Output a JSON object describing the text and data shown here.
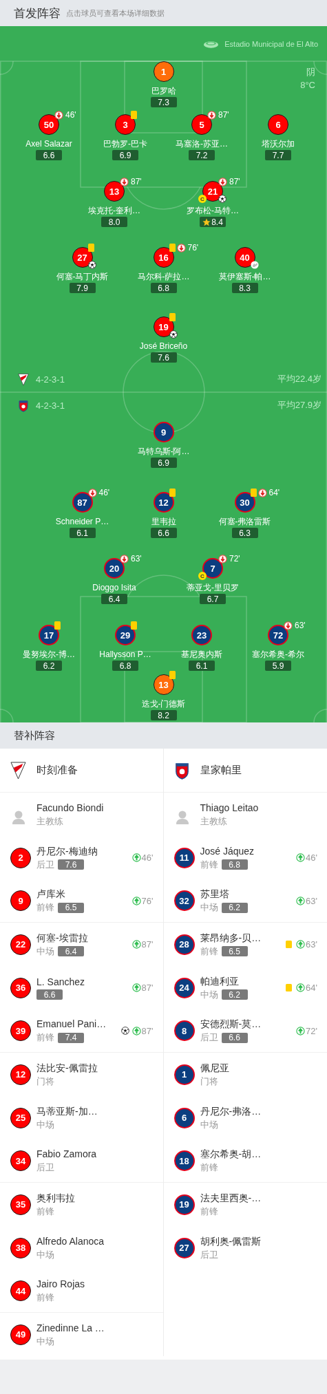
{
  "header": {
    "title": "首发阵容",
    "hint": "点击球员可查看本场详细数据"
  },
  "pitch": {
    "stadium": "Estadio Municipal de El Alto",
    "weather": "阴",
    "temperature": "8°C",
    "home": {
      "formation": "4-2-3-1",
      "average_age": "平均22.4岁",
      "lines": [
        [
          {
            "number": "1",
            "name": "巴罗哈",
            "rating": "7.3",
            "goalkeeper": true,
            "yellow_card": false,
            "goal": false,
            "assist": false,
            "best": false
          }
        ],
        [
          {
            "number": "50",
            "name": "Axel Salazar",
            "rating": "6.6",
            "goalkeeper": false,
            "yellow_card": false,
            "goal": false,
            "assist": false,
            "best": false,
            "sub_off": "46'"
          },
          {
            "number": "3",
            "name": "巴勃罗-巴卡",
            "rating": "6.9",
            "goalkeeper": false,
            "yellow_card": true,
            "goal": false,
            "assist": false,
            "best": false
          },
          {
            "number": "5",
            "name": "马塞洛-苏亚…",
            "rating": "7.2",
            "goalkeeper": false,
            "yellow_card": false,
            "goal": false,
            "assist": false,
            "best": false,
            "sub_off": "87'"
          },
          {
            "number": "6",
            "name": "塔沃尔加",
            "rating": "7.7",
            "goalkeeper": false,
            "yellow_card": false,
            "goal": false,
            "assist": false,
            "best": false
          }
        ],
        [
          {
            "number": "13",
            "name": "埃克托-奎利…",
            "rating": "8.0",
            "goalkeeper": false,
            "yellow_card": false,
            "goal": false,
            "assist": false,
            "best": false,
            "sub_off": "87'"
          },
          {
            "number": "21",
            "name": "罗布松-马特…",
            "rating": "8.4",
            "goalkeeper": false,
            "yellow_card": false,
            "goal": true,
            "assist": false,
            "best": true,
            "sub_off": "87'",
            "captain_badge": "C"
          }
        ],
        [
          {
            "number": "27",
            "name": "何塞-马丁内斯",
            "rating": "7.9",
            "goalkeeper": false,
            "yellow_card": true,
            "goal": true,
            "assist": false,
            "best": false
          },
          {
            "number": "16",
            "name": "马尔科-萨拉…",
            "rating": "6.8",
            "goalkeeper": false,
            "yellow_card": true,
            "goal": false,
            "assist": false,
            "best": false,
            "sub_off": "76'"
          },
          {
            "number": "40",
            "name": "莫伊塞斯-帕…",
            "rating": "8.3",
            "goalkeeper": false,
            "yellow_card": false,
            "goal": false,
            "assist": true,
            "best": false
          }
        ],
        [
          {
            "number": "19",
            "name": "José Briceño",
            "rating": "7.6",
            "goalkeeper": false,
            "yellow_card": true,
            "goal": true,
            "assist": false,
            "best": false
          }
        ]
      ]
    },
    "away": {
      "formation": "4-2-3-1",
      "average_age": "平均27.9岁",
      "lines": [
        [
          {
            "number": "9",
            "name": "马特乌斯-阿…",
            "rating": "6.9",
            "goalkeeper": false,
            "yellow_card": false,
            "goal": false,
            "assist": false,
            "best": false
          }
        ],
        [
          {
            "number": "87",
            "name": "Schneider P…",
            "rating": "6.1",
            "goalkeeper": false,
            "yellow_card": false,
            "goal": false,
            "assist": false,
            "best": false,
            "sub_off": "46'"
          },
          {
            "number": "12",
            "name": "里韦拉",
            "rating": "6.6",
            "goalkeeper": false,
            "yellow_card": true,
            "goal": false,
            "assist": false,
            "best": false
          },
          {
            "number": "30",
            "name": "何塞-弗洛雷斯",
            "rating": "6.3",
            "goalkeeper": false,
            "yellow_card": true,
            "goal": false,
            "assist": false,
            "best": false,
            "sub_off": "64'"
          }
        ],
        [
          {
            "number": "20",
            "name": "Dioggo Isita",
            "rating": "6.4",
            "goalkeeper": false,
            "yellow_card": false,
            "goal": false,
            "assist": false,
            "best": false,
            "sub_off": "63'"
          },
          {
            "number": "7",
            "name": "蒂亚戈-里贝罗",
            "rating": "6.7",
            "goalkeeper": false,
            "yellow_card": false,
            "goal": false,
            "assist": false,
            "best": false,
            "sub_off": "72'",
            "captain_badge": "C"
          }
        ],
        [
          {
            "number": "17",
            "name": "曼努埃尔-博…",
            "rating": "6.2",
            "goalkeeper": false,
            "yellow_card": true,
            "goal": false,
            "assist": false,
            "best": false
          },
          {
            "number": "29",
            "name": "Hallysson P…",
            "rating": "6.8",
            "goalkeeper": false,
            "yellow_card": true,
            "goal": false,
            "assist": false,
            "best": false
          },
          {
            "number": "23",
            "name": "基尼奥内斯",
            "rating": "6.1",
            "goalkeeper": false,
            "yellow_card": false,
            "goal": false,
            "assist": false,
            "best": false
          },
          {
            "number": "72",
            "name": "塞尔希奥-希尔",
            "rating": "5.9",
            "goalkeeper": false,
            "yellow_card": false,
            "goal": false,
            "assist": false,
            "best": false,
            "sub_off": "63'"
          }
        ],
        [
          {
            "number": "13",
            "name": "迭戈-门德斯",
            "rating": "8.2",
            "goalkeeper": true,
            "yellow_card": true,
            "goal": false,
            "assist": false,
            "best": false
          }
        ]
      ]
    }
  },
  "substitutes": {
    "title": "替补阵容",
    "home": {
      "team": "时刻准备",
      "coach": {
        "name": "Facundo Biondi",
        "role": "主教练"
      },
      "players": [
        {
          "number": "2",
          "name": "丹尼尔-梅迪纳",
          "position": "后卫",
          "rating": "7.6",
          "yellow_card": false,
          "goal": false,
          "sub_in": "46'"
        },
        {
          "number": "9",
          "name": "卢库米",
          "position": "前锋",
          "rating": "6.5",
          "yellow_card": false,
          "goal": false,
          "sub_in": "76'"
        },
        {
          "number": "22",
          "name": "何塞-埃雷拉",
          "position": "中场",
          "rating": "6.4",
          "yellow_card": false,
          "goal": false,
          "sub_in": "87'"
        },
        {
          "number": "36",
          "name": "L. Sanchez",
          "rating": "6.6",
          "yellow_card": false,
          "goal": false,
          "sub_in": "87'"
        },
        {
          "number": "39",
          "name": "Emanuel Pani…",
          "position": "前锋",
          "rating": "7.4",
          "yellow_card": false,
          "goal": true,
          "sub_in": "87'"
        },
        {
          "number": "12",
          "name": "法比安-佩雷拉",
          "position": "门将",
          "yellow_card": false,
          "goal": false
        },
        {
          "number": "25",
          "name": "马蒂亚斯-加…",
          "position": "中场",
          "yellow_card": false,
          "goal": false
        },
        {
          "number": "34",
          "name": "Fabio Zamora",
          "position": "后卫",
          "yellow_card": false,
          "goal": false
        },
        {
          "number": "35",
          "name": "奥利韦拉",
          "position": "前锋",
          "yellow_card": false,
          "goal": false
        },
        {
          "number": "38",
          "name": "Alfredo Alanoca",
          "position": "中场",
          "yellow_card": false,
          "goal": false
        },
        {
          "number": "44",
          "name": "Jairo Rojas",
          "position": "前锋",
          "yellow_card": false,
          "goal": false
        },
        {
          "number": "49",
          "name": "Zinedinne La …",
          "position": "中场",
          "yellow_card": false,
          "goal": false
        }
      ]
    },
    "away": {
      "team": "皇家帕里",
      "coach": {
        "name": "Thiago Leitao",
        "role": "主教练"
      },
      "players": [
        {
          "number": "11",
          "name": "José Jáquez",
          "position": "前锋",
          "rating": "6.8",
          "yellow_card": false,
          "goal": false,
          "sub_in": "46'"
        },
        {
          "number": "32",
          "name": "苏里塔",
          "position": "中场",
          "rating": "6.2",
          "yellow_card": false,
          "goal": false,
          "sub_in": "63'"
        },
        {
          "number": "28",
          "name": "莱昂纳多-贝…",
          "position": "前锋",
          "rating": "6.5",
          "yellow_card": true,
          "goal": false,
          "sub_in": "63'"
        },
        {
          "number": "24",
          "name": "帕迪利亚",
          "position": "中场",
          "rating": "6.2",
          "yellow_card": true,
          "goal": false,
          "sub_in": "64'"
        },
        {
          "number": "8",
          "name": "安德烈斯-莫…",
          "position": "后卫",
          "rating": "6.6",
          "yellow_card": false,
          "goal": false,
          "sub_in": "72'"
        },
        {
          "number": "1",
          "name": "佩尼亚",
          "position": "门将",
          "yellow_card": false,
          "goal": false
        },
        {
          "number": "6",
          "name": "丹尼尔-弗洛…",
          "position": "中场",
          "yellow_card": false,
          "goal": false
        },
        {
          "number": "18",
          "name": "塞尔希奥-胡…",
          "position": "前锋",
          "yellow_card": false,
          "goal": false
        },
        {
          "number": "19",
          "name": "法夫里西奥-…",
          "position": "前锋",
          "yellow_card": false,
          "goal": false
        },
        {
          "number": "27",
          "name": "胡利奥-佩雷斯",
          "position": "后卫",
          "yellow_card": false,
          "goal": false
        }
      ]
    }
  }
}
